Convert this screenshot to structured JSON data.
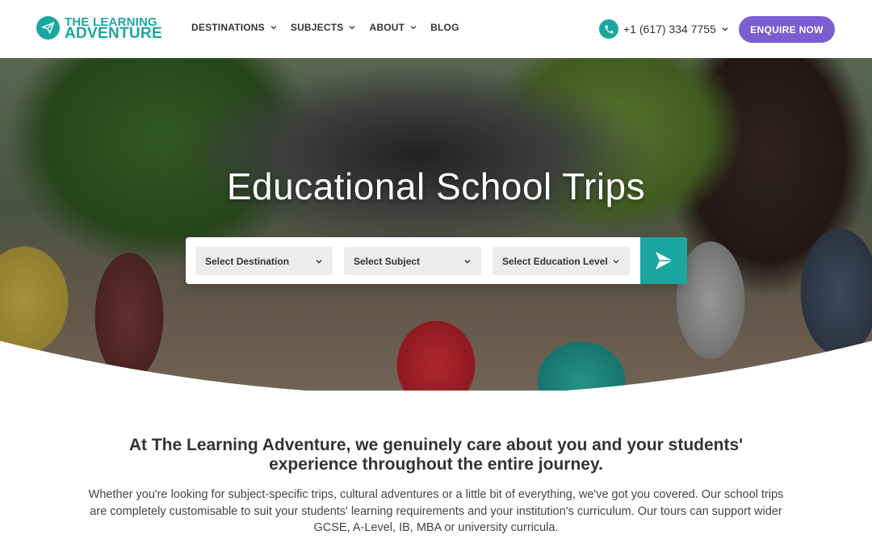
{
  "brand": {
    "line1": "THE LEARNING",
    "line2": "ADVENTURE",
    "accent_color": "#1aa7a0",
    "cta_color": "#7b5fd0"
  },
  "nav": {
    "items": [
      {
        "label": "DESTINATIONS",
        "has_dropdown": true
      },
      {
        "label": "SUBJECTS",
        "has_dropdown": true
      },
      {
        "label": "ABOUT",
        "has_dropdown": true
      },
      {
        "label": "BLOG",
        "has_dropdown": false
      }
    ]
  },
  "contact": {
    "phone": "+1 (617) 334 7755",
    "icon": "phone-icon"
  },
  "header": {
    "cta_label": "ENQUIRE NOW"
  },
  "hero": {
    "title": "Educational School Trips",
    "search": {
      "destination": "Select Destination",
      "subject": "Select Subject",
      "education_level": "Select Education Level",
      "submit_icon": "arrow-right-icon"
    }
  },
  "intro": {
    "title": "At The Learning Adventure, we genuinely care about you and your students' experience throughout the entire journey.",
    "body": "Whether you're looking for subject-specific trips, cultural adventures or a little bit of everything, we've got you covered. Our school trips are completely customisable to suit your students' learning requirements and your institution's curriculum. Our tours can support wider GCSE, A-Level, IB, MBA or university curricula."
  }
}
